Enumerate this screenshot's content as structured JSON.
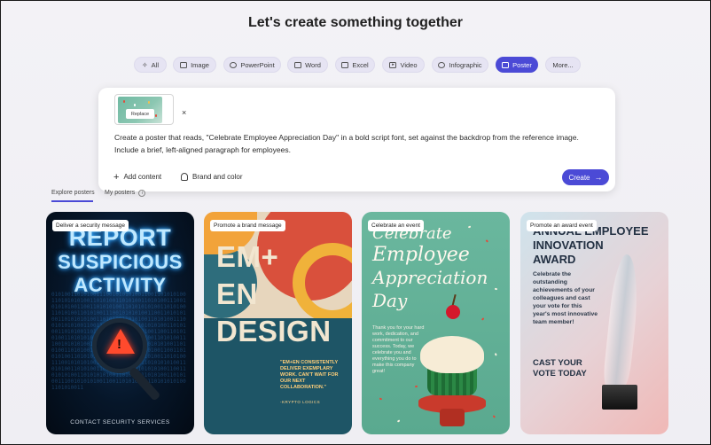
{
  "page": {
    "title": "Let's create something together"
  },
  "chips": [
    {
      "label": "All",
      "icon": "sparkle-icon"
    },
    {
      "label": "Image",
      "icon": "image-icon"
    },
    {
      "label": "PowerPoint",
      "icon": "powerpoint-icon"
    },
    {
      "label": "Word",
      "icon": "word-icon"
    },
    {
      "label": "Excel",
      "icon": "excel-icon"
    },
    {
      "label": "Video",
      "icon": "video-icon"
    },
    {
      "label": "Infographic",
      "icon": "infographic-icon"
    },
    {
      "label": "Poster",
      "icon": "poster-icon",
      "selected": true
    },
    {
      "label": "More...",
      "icon": ""
    }
  ],
  "prompt": {
    "attachment_button": "Replace",
    "close_symbol": "×",
    "text": "Create a poster that reads, \"Celebrate Employee Appreciation Day\" in a bold script font, set against the backdrop from the reference image. Include a brief, left-aligned paragraph for employees.",
    "add_content_label": "Add content",
    "brand_label": "Brand and color",
    "create_label": "Create"
  },
  "tabs": {
    "explore": "Explore posters",
    "mine": "My posters"
  },
  "posters": [
    {
      "tag": "Deliver a security message",
      "lines": [
        "REPORT",
        "SUSPICIOUS",
        "ACTIVITY"
      ],
      "footer": "CONTACT SECURITY SERVICES"
    },
    {
      "tag": "Promote a brand message",
      "lines": [
        "EM+",
        "EN",
        "DESIGN"
      ],
      "quote": "\"EM+EN CONSISTENTLY DELIVER EXEMPLARY WORK. CAN'T WAIT FOR OUR NEXT COLLABORATION.\"",
      "byline": "-KRYPTO LOGICS"
    },
    {
      "tag": "Celebrate an event",
      "lines": [
        "Celebrate",
        "Employee",
        "Appreciation",
        "Day"
      ],
      "body": "Thank you for your hard work, dedication, and commitment to our success. Today, we celebrate you and everything you do to make this company great!"
    },
    {
      "tag": "Promote an award event",
      "lines": [
        "ANNUAL EMPLOYEE",
        "INNOVATION",
        "AWARD"
      ],
      "body": "Celebrate the outstanding achievements of your colleagues and cast your vote for this year's most innovative team member!",
      "cta_lines": [
        "CAST YOUR",
        "VOTE TODAY"
      ]
    }
  ],
  "colors": {
    "accent": "#4b4ad6"
  }
}
